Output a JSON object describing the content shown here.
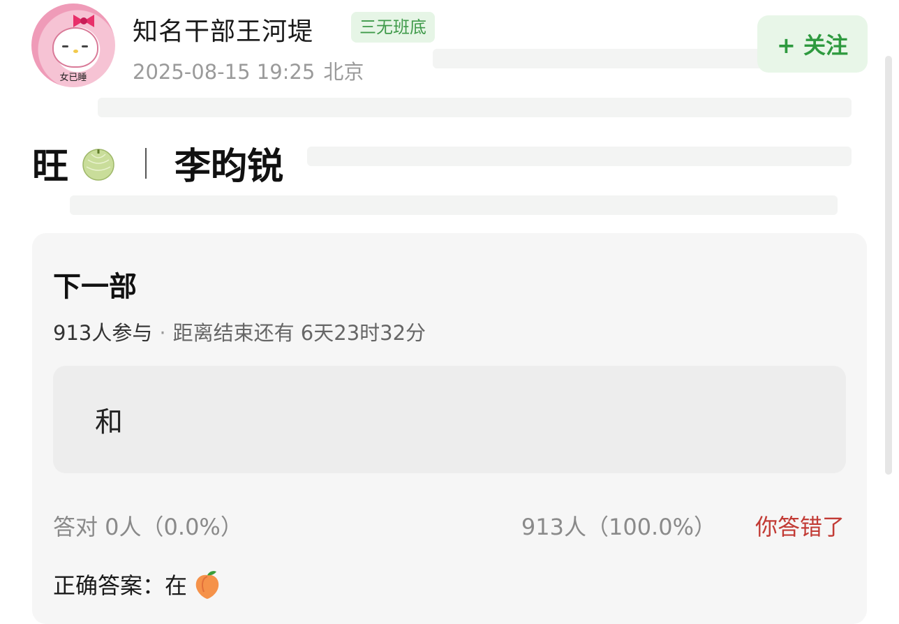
{
  "post": {
    "username": "知名干部王河堤",
    "badge": "三无班底",
    "datetime": "2025-08-15 19:25",
    "location": "北京",
    "follow_label": "+ 关注",
    "avatar_caption": "女已睡",
    "headline_left": "旺",
    "headline_right": "李昀锐"
  },
  "poll": {
    "title": "下一部",
    "participants": "913人参与",
    "separator": "·",
    "countdown": "距离结束还有 6天23时32分",
    "option_text": "和",
    "correct_stat": "答对 0人（0.0%）",
    "wrong_stat": "913人（100.0%）",
    "wrong_label": "你答错了",
    "answer_label": "正确答案：在"
  },
  "colors": {
    "accent_green": "#2e9a3f",
    "badge_bg": "#e6f5e6",
    "wrong_red": "#c23b35"
  },
  "icons": {
    "melon": "melon-icon",
    "peach": "peach-icon"
  }
}
